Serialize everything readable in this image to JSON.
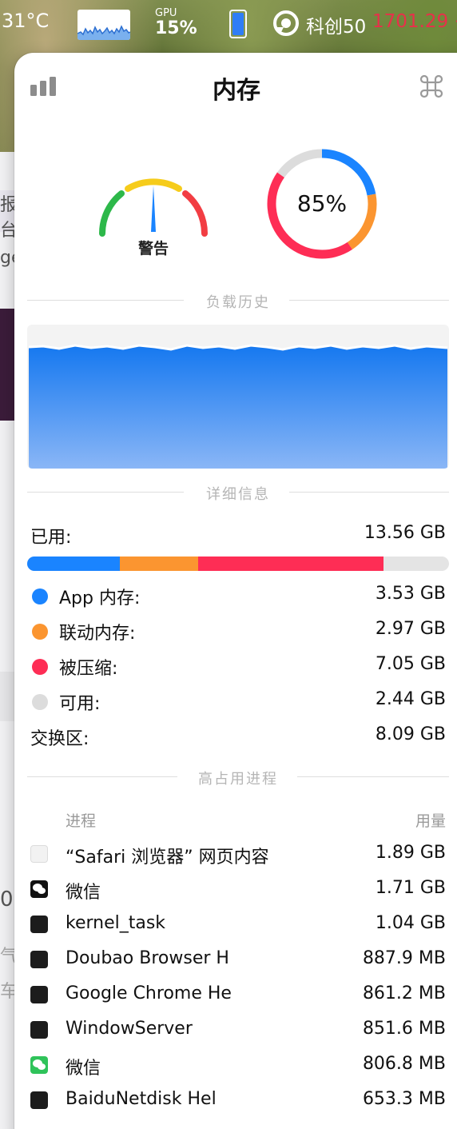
{
  "statusbar": {
    "temperature": "31°C",
    "gpu_label": "GPU",
    "gpu_value": "15%",
    "stock_name": "科创50",
    "stock_value": "1701.29 +",
    "stock_color": "#e8304a",
    "memory_icon_color": "#2f7df6"
  },
  "panel": {
    "title": "内存",
    "left_icon": "bar-chart-icon",
    "right_icon": "command-icon",
    "gauge_label": "警告",
    "usage_percent_label": "85%",
    "usage_percent": 85
  },
  "sections": {
    "history": "负载历史",
    "details": "详细信息",
    "top_processes": "高占用进程"
  },
  "details": {
    "used": {
      "label": "已用:",
      "value": "13.56 GB"
    },
    "items": [
      {
        "label": "App 内存:",
        "value": "3.53 GB",
        "color": "#1a84ff"
      },
      {
        "label": "联动内存:",
        "value": "2.97 GB",
        "color": "#fb9530"
      },
      {
        "label": "被压缩:",
        "value": "7.05 GB",
        "color": "#fe2d55"
      },
      {
        "label": "可用:",
        "value": "2.44 GB",
        "color": "#dcdcdc"
      }
    ],
    "swap": {
      "label": "交换区:",
      "value": "8.09 GB"
    }
  },
  "processes": {
    "header_name": "进程",
    "header_usage": "用量",
    "rows": [
      {
        "name": "“Safari 浏览器” 网页内容",
        "value": "1.89 GB",
        "icon": "document-icon"
      },
      {
        "name": "微信",
        "value": "1.71 GB",
        "icon": "wechat-icon"
      },
      {
        "name": "kernel_task",
        "value": "1.04 GB",
        "icon": "terminal-icon"
      },
      {
        "name": "Doubao Browser H",
        "value": "887.9 MB",
        "icon": "terminal-icon"
      },
      {
        "name": "Google Chrome He",
        "value": "861.2 MB",
        "icon": "terminal-icon"
      },
      {
        "name": "WindowServer",
        "value": "851.6 MB",
        "icon": "terminal-icon"
      },
      {
        "name": "微信",
        "value": "806.8 MB",
        "icon": "wechat-icon"
      },
      {
        "name": "BaiduNetdisk Hel",
        "value": "653.3 MB",
        "icon": "terminal-icon"
      }
    ]
  },
  "background_fragments": [
    "报台",
    "ge",
    "0",
    "气",
    "车"
  ]
}
